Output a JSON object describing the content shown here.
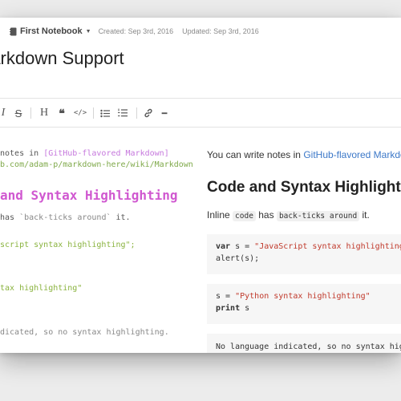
{
  "header": {
    "notebook": "First Notebook",
    "created": "Created: Sep 3rd, 2016",
    "updated": "Updated: Sep 3rd, 2016"
  },
  "note_title": "Markdown Support",
  "toolbar": {
    "icons": [
      "italic-icon",
      "strikethrough-icon",
      "heading-icon",
      "quote-icon",
      "code-icon",
      "bullet-list-icon",
      "numbered-list-icon",
      "link-icon",
      "horizontal-rule-icon"
    ],
    "italic": "I",
    "strike": "S",
    "heading": "H",
    "quote": "❝",
    "code": "</>",
    "hr": "━"
  },
  "editor": {
    "line1_prefix": "notes in ",
    "line1_link": "[GitHub-flavored Markdown]",
    "line2_url": "b.com/adam-p/markdown-here/wiki/Markdown-",
    "heading": "and Syntax Highlighting",
    "inline_prefix": "has ",
    "inline_code": "`back-ticks around`",
    "inline_suffix": " it.",
    "js_line": "script syntax highlighting\";",
    "py_line": "tax highlighting\"",
    "plain_line": "dicated, so no syntax highlighting."
  },
  "preview": {
    "intro_prefix": "You can write notes in ",
    "intro_link": "GitHub-flavored Markdown",
    "heading": "Code and Syntax Highlighting",
    "inline_1": "Inline ",
    "inline_code_1": "code",
    "inline_2": " has ",
    "inline_code_2": "back-ticks around",
    "inline_3": " it.",
    "js_kw": "var",
    "js_mid": " s = ",
    "js_str": "\"JavaScript syntax highlighting\"",
    "js_end": ";",
    "js_line2": "alert(s);",
    "py_pre": "s = ",
    "py_str": "\"Python syntax highlighting\"",
    "py_kw": "print",
    "py_rest": " s",
    "plain": "No language indicated, so no syntax highlighting."
  },
  "colors": {
    "link": "#3c78c8",
    "md_link": "#c678dd",
    "md_heading": "#d058d0",
    "md_string": "#8ab33f",
    "code_string": "#c0392b"
  }
}
